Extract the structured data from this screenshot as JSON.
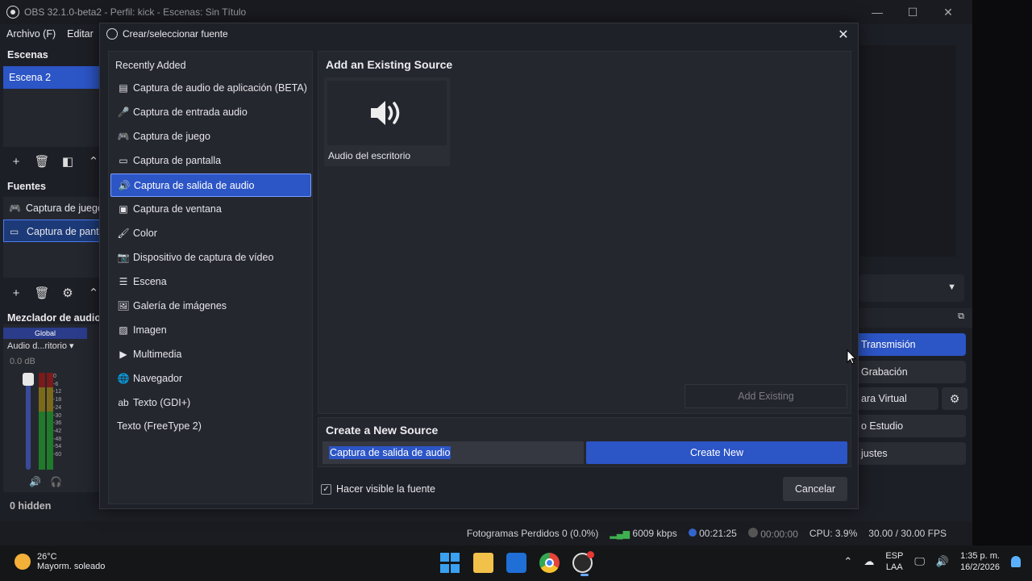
{
  "window": {
    "title": "OBS 32.1.0-beta2 - Perfil: kick - Escenas: Sin Título",
    "controls": [
      "—",
      "☐",
      "✕"
    ]
  },
  "menu": [
    "Archivo (F)",
    "Editar"
  ],
  "scenes": {
    "title": "Escenas",
    "items": [
      "Escena 2"
    ]
  },
  "sources": {
    "title": "Fuentes",
    "items": [
      "Captura de juego",
      "Captura de pantalla"
    ]
  },
  "mixer": {
    "title": "Mezclador de audio",
    "global_label": "Global",
    "channel": "Audio d...ritorio",
    "db": "0.0 dB",
    "scale": [
      "0",
      "-6",
      "-12",
      "-18",
      "-24",
      "-30",
      "-36",
      "-42",
      "-48",
      "-54",
      "-60"
    ],
    "hidden": "0 hidden"
  },
  "controls": {
    "transmision": "Transmisión",
    "grabacion": "Grabación",
    "camara_virtual": "ara Virtual",
    "estudio": "o Estudio",
    "ajustes": "justes"
  },
  "status": {
    "dropped": "Fotogramas Perdidos 0 (0.0%)",
    "bitrate": "6009 kbps",
    "stream_time": "00:21:25",
    "rec_time": "00:00:00",
    "cpu": "CPU: 3.9%",
    "fps": "30.00 / 30.00 FPS"
  },
  "dialog": {
    "title": "Crear/seleccionar fuente",
    "recently_added": "Recently Added",
    "types": [
      {
        "label": "Captura de audio de aplicación (BETA)",
        "icon": "app-audio-icon"
      },
      {
        "label": "Captura de entrada audio",
        "icon": "microphone-icon"
      },
      {
        "label": "Captura de juego",
        "icon": "gamepad-icon"
      },
      {
        "label": "Captura de pantalla",
        "icon": "monitor-icon"
      },
      {
        "label": "Captura de salida de audio",
        "icon": "speaker-icon"
      },
      {
        "label": "Captura de ventana",
        "icon": "window-icon"
      },
      {
        "label": "Color",
        "icon": "brush-icon"
      },
      {
        "label": "Dispositivo de captura de vídeo",
        "icon": "camera-icon"
      },
      {
        "label": "Escena",
        "icon": "list-icon"
      },
      {
        "label": "Galería de imágenes",
        "icon": "gallery-icon"
      },
      {
        "label": "Imagen",
        "icon": "image-icon"
      },
      {
        "label": "Multimedia",
        "icon": "play-icon"
      },
      {
        "label": "Navegador",
        "icon": "globe-icon"
      },
      {
        "label": "Texto (GDI+)",
        "icon": "text-icon"
      },
      {
        "label": "Texto (FreeType 2)",
        "icon": ""
      }
    ],
    "selected_type": "Captura de salida de audio",
    "existing_header": "Add an Existing Source",
    "existing_items": [
      {
        "label": "Audio del escritorio",
        "icon": "speaker-icon"
      }
    ],
    "add_existing": "Add Existing",
    "create_header": "Create a New Source",
    "new_name": "Captura de salida de audio",
    "create_new": "Create New",
    "visible_label": "Hacer visible la fuente",
    "visible_checked": true,
    "cancel": "Cancelar"
  },
  "taskbar": {
    "weather_temp": "26°C",
    "weather_desc": "Mayorm. soleado",
    "lang_top": "ESP",
    "lang_bottom": "LAA",
    "time": "1:35 p. m.",
    "date": "16/2/2026"
  },
  "colors": {
    "accent": "#2c55c6",
    "background": "#1d1f26",
    "panel": "#25272f"
  }
}
